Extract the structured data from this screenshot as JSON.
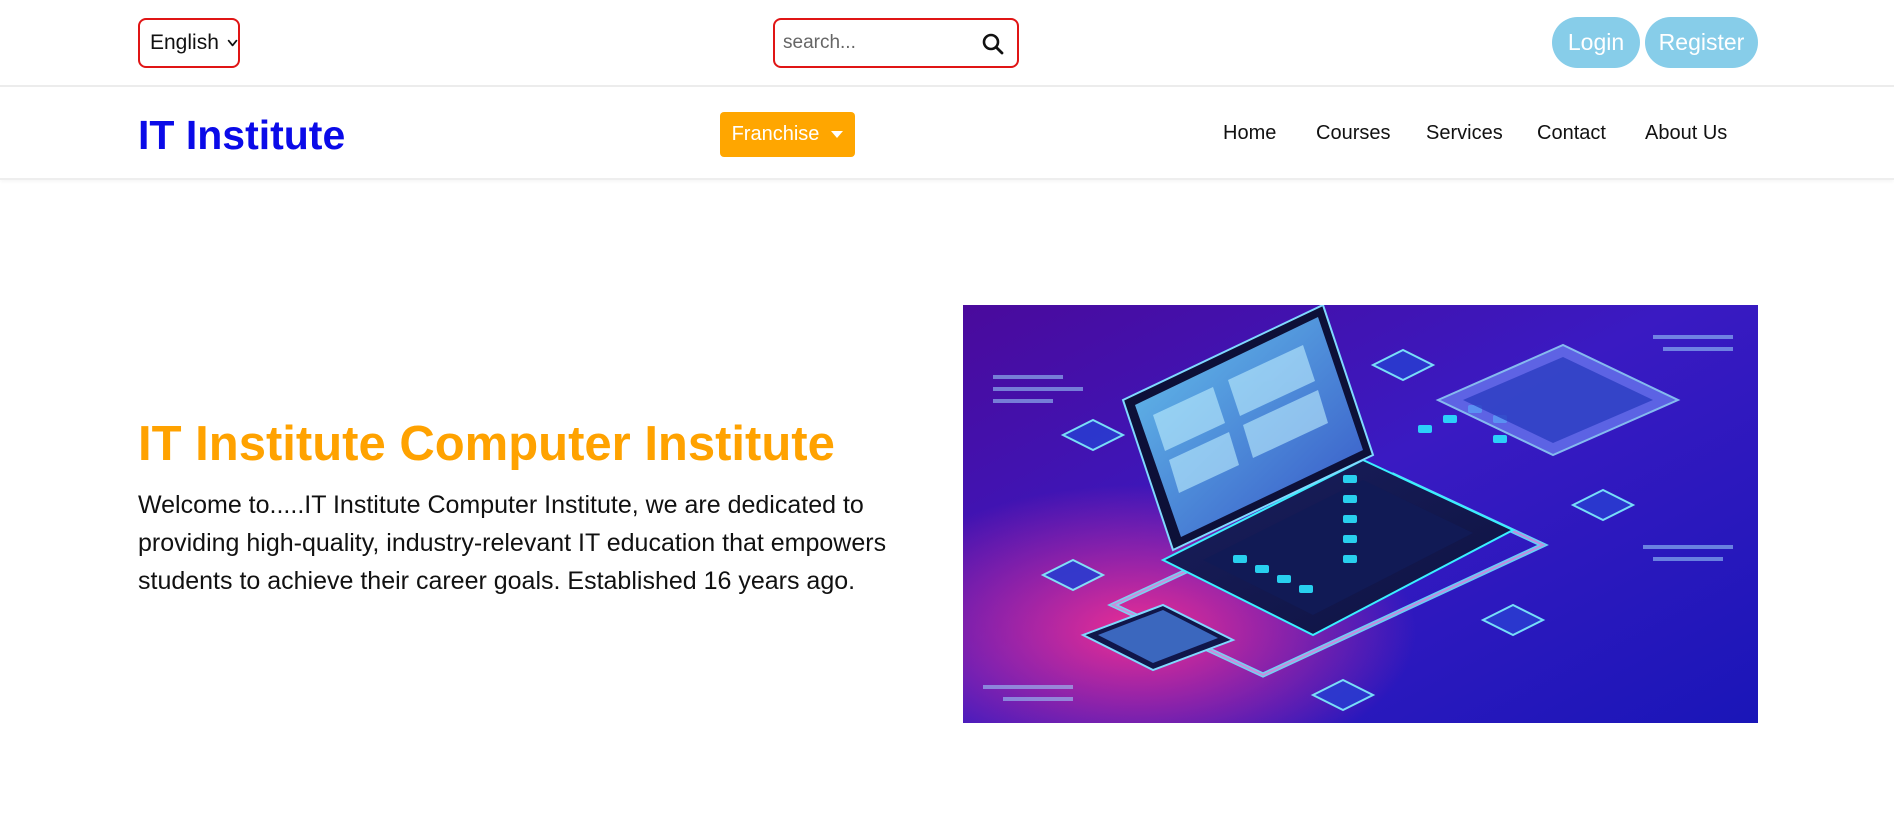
{
  "topbar": {
    "language": {
      "selected": "English"
    },
    "search": {
      "placeholder": "search..."
    },
    "login_label": "Login",
    "register_label": "Register"
  },
  "navbar": {
    "brand": "IT Institute",
    "franchise_label": "Franchise",
    "links": [
      "Home",
      "Courses",
      "Services",
      "Contact",
      "About Us"
    ]
  },
  "hero": {
    "title": "IT Institute Computer Institute",
    "text": "Welcome to.....IT Institute Computer Institute, we are dedicated to providing high-quality, industry-relevant IT education that empowers students to achieve their career goals. Established 16 years ago."
  },
  "colors": {
    "accent_orange": "#ffa600",
    "brand_blue": "#0a0ae8",
    "pill_blue": "#87cde9",
    "highlight_border": "#e01515"
  }
}
